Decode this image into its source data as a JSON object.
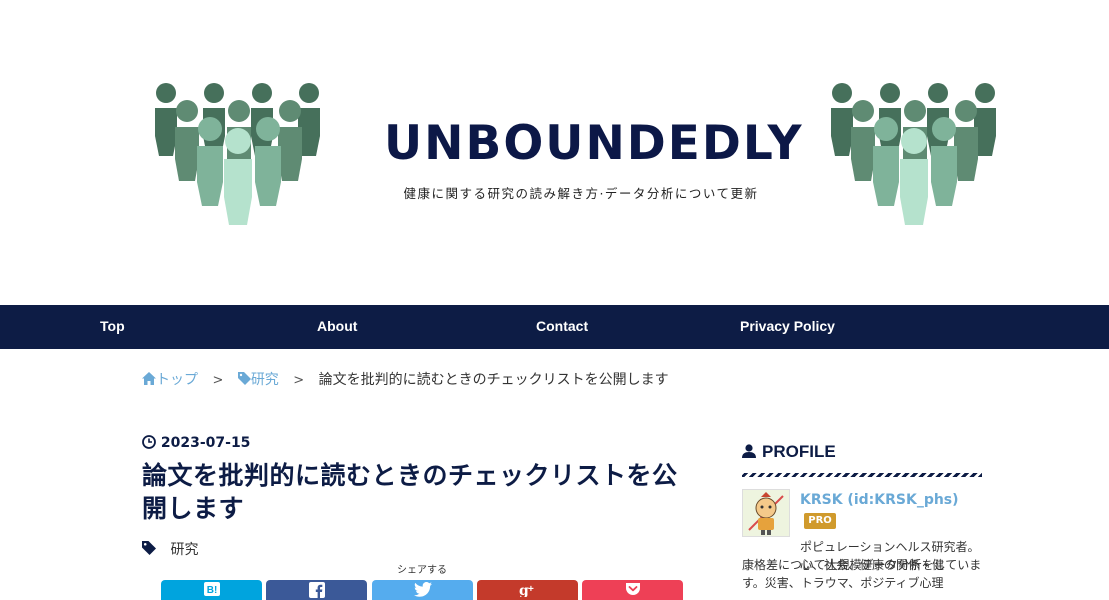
{
  "header": {
    "title": "UNBOUNDEDLY",
    "tagline": "健康に関する研究の読み解き方·データ分析について更新"
  },
  "nav": {
    "items": [
      "Top",
      "About",
      "Contact",
      "Privacy Policy"
    ]
  },
  "breadcrumb": {
    "home": "トップ",
    "category": "研究",
    "current": "論文を批判的に読むときのチェックリストを公開します",
    "separator": ">"
  },
  "post": {
    "date": "2023-07-15",
    "title": "論文を批判的に読むときのチェックリストを公開します",
    "category": "研究",
    "share_label": "シェアする"
  },
  "share_buttons": [
    {
      "name": "hatena",
      "icon": "B!",
      "color": "#00a4de"
    },
    {
      "name": "facebook",
      "icon": "f",
      "color": "#3b5998"
    },
    {
      "name": "twitter",
      "icon": "twitter-bird",
      "color": "#55acee"
    },
    {
      "name": "google-plus",
      "icon": "g+",
      "color": "#c43a2b"
    },
    {
      "name": "pocket",
      "icon": "pocket",
      "color": "#ee4056"
    }
  ],
  "sidebar": {
    "heading": "PROFILE",
    "name": "KRSK (id:KRSK_phs)",
    "badge": "PRO",
    "bio_line1": "ポピュレーションヘルス研究者。心、社会、健康の関係・健",
    "bio_line2": "康格差について大規模データ分析をしています。災害、トラウマ、ポジティブ心理"
  },
  "colors": {
    "nav_bg": "#0d1c45",
    "title": "#0c1847",
    "link": "#6aa9d6",
    "people_dark": "#46705b",
    "people_mid": "#6b9a80",
    "people_light": "#a7d9c1"
  }
}
